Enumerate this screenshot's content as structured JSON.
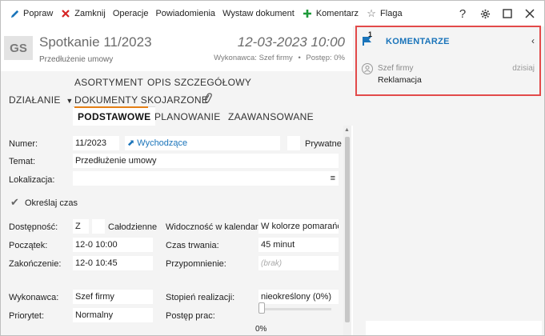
{
  "toolbar": {
    "items": [
      {
        "label": "Popraw",
        "icon": "pencil-icon"
      },
      {
        "label": "Zamknij",
        "icon": "close-x-icon"
      },
      {
        "label": "Operacje"
      },
      {
        "label": "Powiadomienia"
      },
      {
        "label": "Wystaw dokument"
      },
      {
        "label": "Komentarz",
        "icon": "plus-icon"
      },
      {
        "label": "Flaga",
        "icon": "star-icon"
      }
    ],
    "window_buttons": [
      "help-icon",
      "gear-icon",
      "maximize-icon",
      "close-icon"
    ]
  },
  "header": {
    "avatar": "GS",
    "title": "Spotkanie 11/2023",
    "subtitle": "Przedłużenie umowy",
    "date": "12-03-2023 10:00",
    "executor": "Wykonawca: Szef firmy",
    "separator": "•",
    "progress": "Postęp: 0%"
  },
  "tabs": {
    "dzialanie": "DZIAŁANIE",
    "asortyment": "ASORTYMENT",
    "opis": "OPIS SZCZEGÓŁOWY",
    "dokumenty": "DOKUMENTY SKOJARZONE",
    "podstawowe": "PODSTAWOWE",
    "planowanie": "PLANOWANIE",
    "zaawansowane": "ZAAWANSOWANE"
  },
  "form": {
    "numer_label": "Numer:",
    "numer_value": "11/2023",
    "kierunek": "Wychodzące",
    "prywatne": "Prywatne",
    "temat_label": "Temat:",
    "temat_value": "Przedłużenie umowy",
    "lokalizacja_label": "Lokalizacja:",
    "okreslaj_czas": "Określaj czas",
    "dostepnosc_label": "Dostępność:",
    "dostepnosc_value": "Z",
    "calodzienne": "Całodzienne",
    "widocznosc_label": "Widoczność w kalendarzu:",
    "widocznosc_value": "W kolorze pomarańcz.",
    "poczatek_label": "Początek:",
    "poczatek_value": "12-0 10:00",
    "czas_trwania_label": "Czas trwania:",
    "czas_trwania_value": "45 minut",
    "zakonczenie_label": "Zakończenie:",
    "zakonczenie_value": "12-0 10:45",
    "przypomnienie_label": "Przypomnienie:",
    "przypomnienie_value": "(brak)",
    "wykonawca_label": "Wykonawca:",
    "wykonawca_value": "Szef firmy",
    "stopien_label": "Stopień realizacji:",
    "stopien_value": "nieokreślony  (0%)",
    "priorytet_label": "Priorytet:",
    "priorytet_value": "Normalny",
    "postep_label": "Postęp prac:",
    "postep_value": "0%"
  },
  "comments": {
    "badge": "1",
    "title": "KOMENTARZE",
    "author": "Szef firmy",
    "when": "dzisiaj",
    "text": "Reklamacja"
  },
  "colors": {
    "accent_blue": "#1a74ba",
    "tab_underline": "#e47f16",
    "highlight_border": "#e24a4a",
    "close_red": "#d62424",
    "plus_green": "#1e9a3a"
  }
}
